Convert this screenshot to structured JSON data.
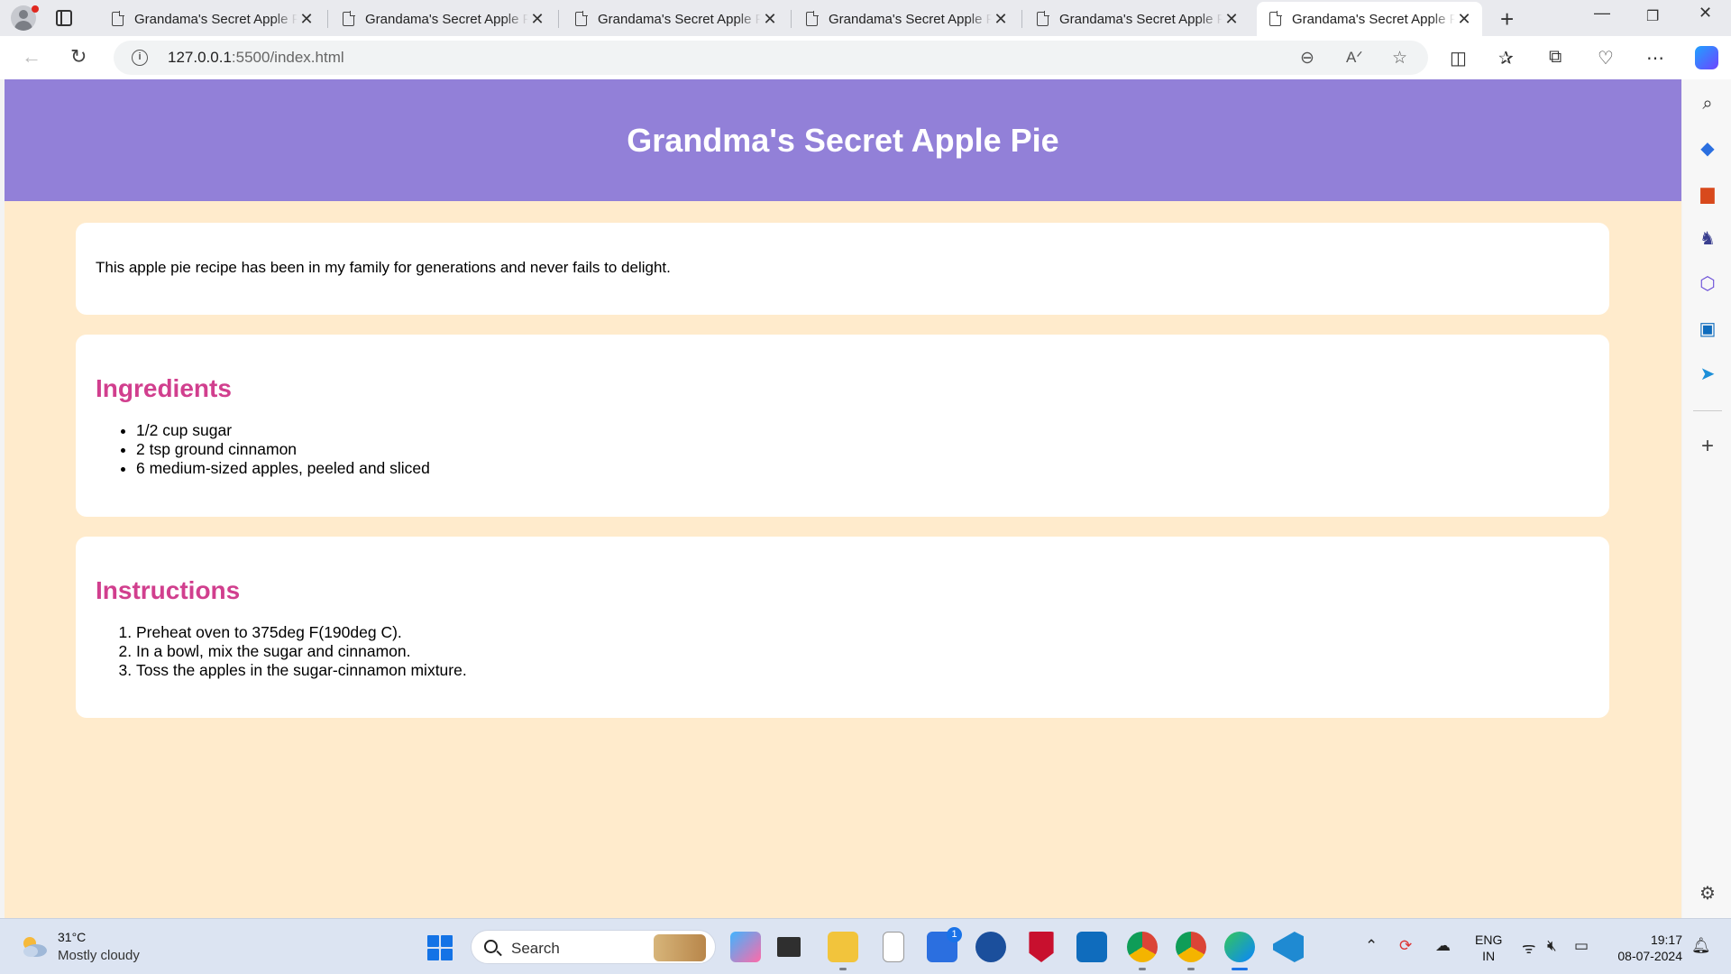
{
  "browser": {
    "tabs": [
      {
        "title": "Grandama's Secret Apple Pie",
        "active": false
      },
      {
        "title": "Grandama's Secret Apple Pie",
        "active": false
      },
      {
        "title": "Grandama's Secret Apple Pie",
        "active": false
      },
      {
        "title": "Grandama's Secret Apple Pie",
        "active": false
      },
      {
        "title": "Grandama's Secret Apple Pie",
        "active": false
      },
      {
        "title": "Grandama's Secret Apple Pie",
        "active": true
      }
    ],
    "address": {
      "host": "127.0.0.1",
      "path": ":5500/index.html"
    }
  },
  "page": {
    "title": "Grandma's Secret Apple Pie",
    "intro": "This apple pie recipe has been in my family for generations and never fails to delight.",
    "ingredients": {
      "heading": "Ingredients",
      "items": [
        "1/2 cup sugar",
        "2 tsp ground cinnamon",
        "6 medium-sized apples, peeled and sliced"
      ]
    },
    "instructions": {
      "heading": "Instructions",
      "steps": [
        "Preheat oven to 375deg F(190deg C).",
        "In a bowl, mix the sugar and cinnamon.",
        "Toss the apples in the sugar-cinnamon mixture."
      ]
    },
    "colors": {
      "header": "#9280d8",
      "background": "#ffebcc",
      "heading": "#d13f8e"
    }
  },
  "taskbar": {
    "weather": {
      "temp": "31°C",
      "desc": "Mostly cloudy"
    },
    "search_placeholder": "Search",
    "store_badge": "1",
    "lang": {
      "line1": "ENG",
      "line2": "IN"
    },
    "clock": {
      "time": "19:17",
      "date": "08-07-2024"
    }
  }
}
